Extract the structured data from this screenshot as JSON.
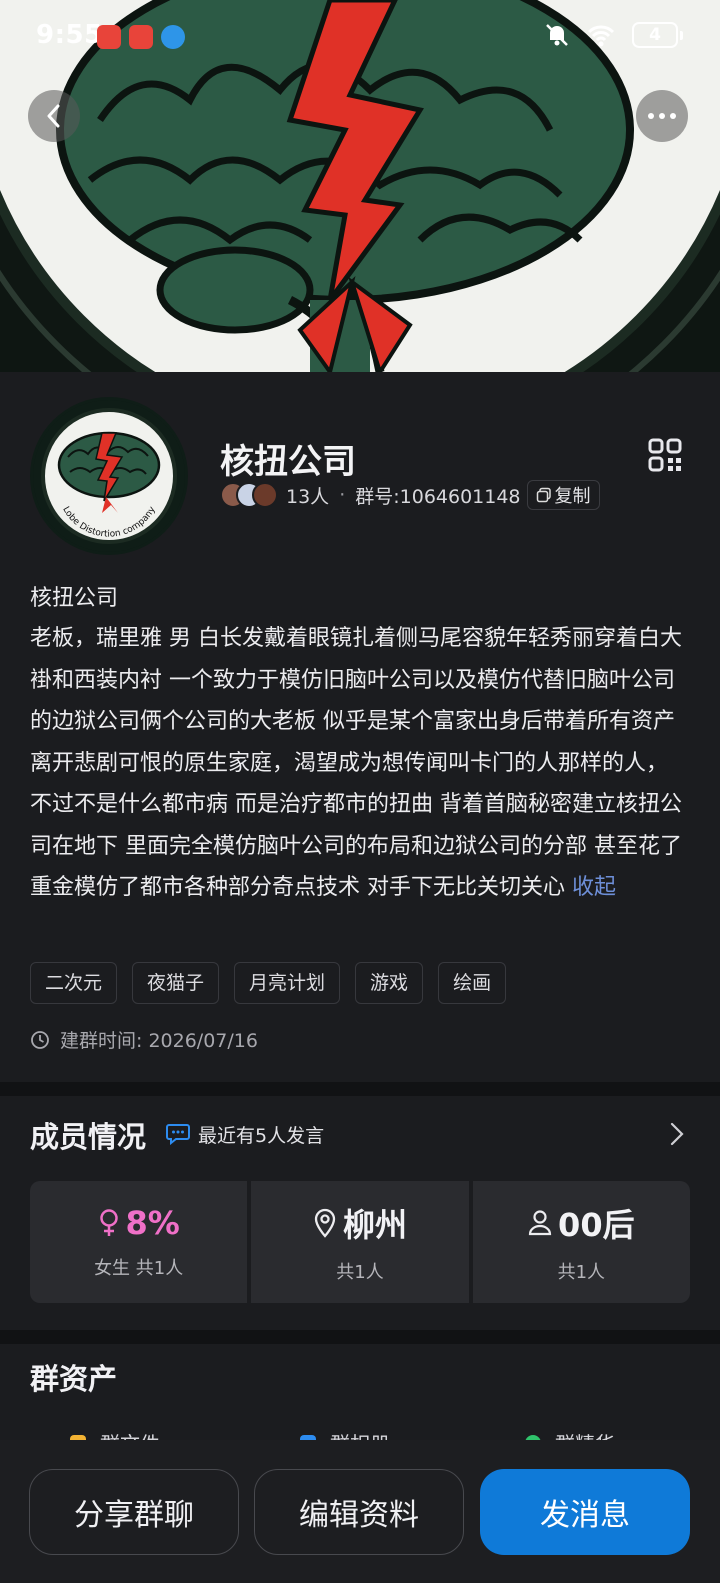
{
  "status_bar": {
    "time": "9:55",
    "battery": "4"
  },
  "group": {
    "name": "核扭公司",
    "member_count": "13人",
    "number_label": "群号:1064601148",
    "copy_label": "复制",
    "avatar_caption": "Lobe Distortion company"
  },
  "description": {
    "title": "核扭公司",
    "body": "老板，瑞里雅 男 白长发戴着眼镜扎着侧马尾容貌年轻秀丽穿着白大褂和西装内衬 一个致力于模仿旧脑叶公司以及模仿代替旧脑叶公司的边狱公司俩个公司的大老板 似乎是某个富家出身后带着所有资产离开悲剧可恨的原生家庭，渴望成为想传闻叫卡门的人那样的人， 不过不是什么都市病 而是治疗都市的扭曲 背着首脑秘密建立核扭公司在地下 里面完全模仿脑叶公司的布局和边狱公司的分部 甚至花了重金模仿了都市各种部分奇点技术 对手下无比关切关心",
    "collapse_label": "收起"
  },
  "tags": [
    "二次元",
    "夜猫子",
    "月亮计划",
    "游戏",
    "绘画"
  ],
  "created": {
    "label": "建群时间: 2026/07/16"
  },
  "members": {
    "title": "成员情况",
    "recent_text": "最近有5人发言",
    "cards": [
      {
        "value": "8%",
        "sub": "女生 共1人",
        "icon": "female-icon"
      },
      {
        "value": "柳州",
        "sub": "共1人",
        "icon": "location-pin-icon"
      },
      {
        "value": "00后",
        "sub": "共1人",
        "icon": "person-icon"
      }
    ]
  },
  "assets": {
    "title": "群资产",
    "items": [
      "群文件",
      "群相册",
      "群精华"
    ]
  },
  "bottom": {
    "share_label": "分享群聊",
    "edit_label": "编辑资料",
    "send_label": "发消息"
  },
  "colors": {
    "accent": "#0f7ad8",
    "pink": "#f070c8",
    "link": "#6e8fd8",
    "background": "#1b1c1f"
  }
}
